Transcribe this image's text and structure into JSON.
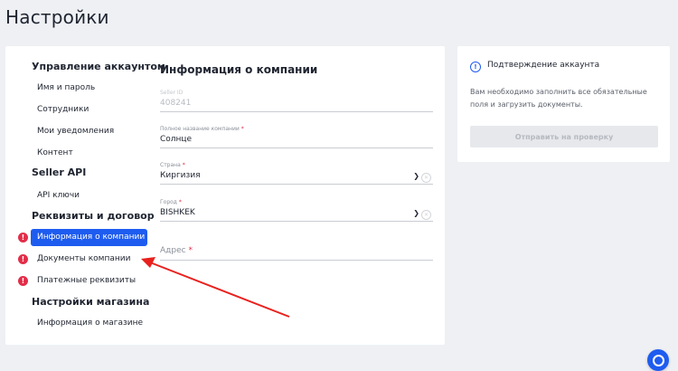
{
  "page": {
    "title": "Настройки"
  },
  "sidebar": {
    "sections": [
      {
        "title": "Управление аккаунтом",
        "items": [
          "Имя и пароль",
          "Сотрудники",
          "Мои уведомления",
          "Контент"
        ]
      },
      {
        "title": "Seller API",
        "items": [
          "API ключи"
        ]
      },
      {
        "title": "Реквизиты и договор",
        "items": [
          "Информация о компании",
          "Документы компании",
          "Платежные реквизиты"
        ]
      },
      {
        "title": "Настройки магазина",
        "items": [
          "Информация о магазине"
        ]
      }
    ],
    "alert_glyph": "!"
  },
  "form": {
    "title": "Информация о компании",
    "seller_id": {
      "label": "Seller ID",
      "value": "408241"
    },
    "company_name": {
      "label": "Полное название компании",
      "required": "*",
      "value": "Солнце"
    },
    "country": {
      "label": "Страна",
      "required": "*",
      "value": "Киргизия"
    },
    "city": {
      "label": "Город",
      "required": "*",
      "value": "BISHKEK"
    },
    "address": {
      "placeholder": "Адрес",
      "required": "*"
    }
  },
  "verification": {
    "title": "Подтверждение аккаунта",
    "text": "Вам необходимо заполнить все обязательные поля и загрузить документы.",
    "button": "Отправить на проверку"
  },
  "icons": [
    "alert-icon",
    "chevron-down-icon",
    "clear-icon",
    "info-icon",
    "chat-icon"
  ],
  "colors": {
    "accent": "#1e5cf0",
    "alert": "#e32d48",
    "annotation_arrow": "#e8211d"
  }
}
